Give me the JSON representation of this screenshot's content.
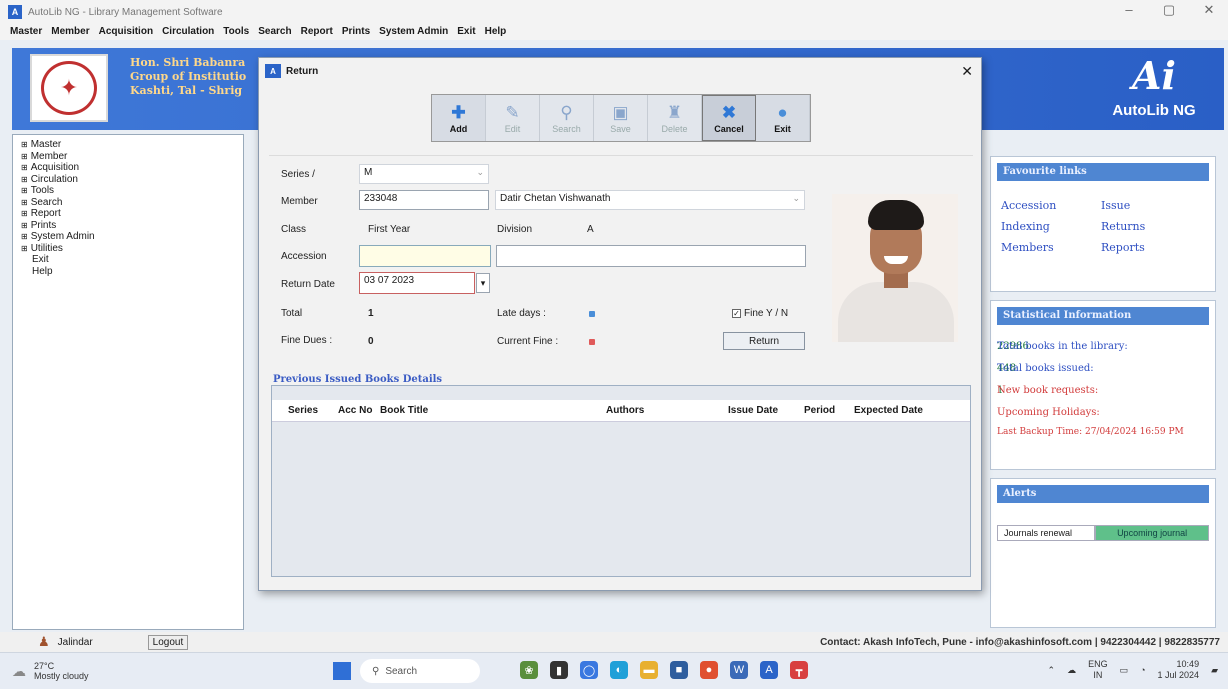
{
  "window": {
    "title": "AutoLib NG - Library Management Software",
    "controls": [
      "–",
      "▢",
      "✕"
    ]
  },
  "menubar": [
    "Master",
    "Member",
    "Acquisition",
    "Circulation",
    "Tools",
    "Search",
    "Report",
    "Prints",
    "System Admin",
    "Exit",
    "Help"
  ],
  "header": {
    "institution_lines": [
      "Hon. Shri Babanra",
      "Group of Institutio",
      "Kashti, Tal - Shrig"
    ],
    "brand_mark": "Ai",
    "brand_name": "AutoLib NG"
  },
  "left_nav": {
    "tree_items": [
      "Master",
      "Member",
      "Acquisition",
      "Circulation",
      "Tools",
      "Search",
      "Report",
      "Prints",
      "System Admin",
      "Utilities"
    ],
    "plain_items": [
      "Exit",
      "Help"
    ]
  },
  "favourite_links": {
    "title": "Favourite links",
    "links": [
      "Accession",
      "Issue",
      "Indexing",
      "Returns",
      "Members",
      "Reports"
    ]
  },
  "statistics": {
    "title": "Statistical Information",
    "rows": [
      {
        "label": "Total books in the library:",
        "value": "22986"
      },
      {
        "label": "Total books issued:",
        "value": "448"
      },
      {
        "label": "New book requests:",
        "value": "1"
      },
      {
        "label": "Upcoming Holidays:",
        "value": ""
      }
    ],
    "last_backup": "Last Backup Time: 27/04/2024 16:59 PM"
  },
  "alerts": {
    "title": "Alerts",
    "tabs": [
      "Journals renewal",
      "Upcoming journal"
    ]
  },
  "statusbar": {
    "user": "Jalindar",
    "logout": "Logout",
    "contact": "Contact: Akash InfoTech, Pune - info@akashinfosoft.com | 9422304442 | 9822835777"
  },
  "dialog": {
    "title": "Return",
    "toolbar": [
      {
        "label": "Add",
        "icon": "add-icon"
      },
      {
        "label": "Edit",
        "icon": "edit-icon"
      },
      {
        "label": "Search",
        "icon": "search-icon"
      },
      {
        "label": "Save",
        "icon": "save-icon"
      },
      {
        "label": "Delete",
        "icon": "delete-icon"
      },
      {
        "label": "Cancel",
        "icon": "cancel-icon"
      },
      {
        "label": "Exit",
        "icon": "exit-icon"
      }
    ],
    "form": {
      "series_label": "Series /",
      "series_value": "M",
      "member_label": "Member",
      "member_id": "233048",
      "member_name": "Datir Chetan Vishwanath",
      "class_label": "Class",
      "class_value": "First Year",
      "division_label": "Division",
      "division_value": "A",
      "accession_label": "Accession",
      "accession_value": "",
      "accession_title_value": "",
      "return_date_label": "Return Date",
      "return_date_value": "03 07 2023",
      "total_label": "Total",
      "total_value": "1",
      "late_days_label": "Late days :",
      "fine_yn_label": "Fine Y / N",
      "fine_dues_label": "Fine Dues :",
      "fine_dues_value": "0",
      "current_fine_label": "Current Fine :",
      "return_button": "Return"
    },
    "previous_books": {
      "title": "Previous Issued Books Details",
      "columns": [
        "Series",
        "Acc No",
        "Book Title",
        "Authors",
        "Issue Date",
        "Period",
        "Expected Date"
      ],
      "rows": []
    }
  },
  "taskbar": {
    "weather_temp": "27°C",
    "weather_desc": "Mostly cloudy",
    "search_placeholder": "Search",
    "lang_top": "ENG",
    "lang_bottom": "IN",
    "time": "10:49",
    "date": "1 Jul 2024"
  },
  "colors": {
    "header_blue": "#3f78d8",
    "link_blue": "#2e4fc2",
    "stat_green": "#1d7a3e",
    "alert_red": "#d23c3c",
    "tab_green": "#5fc08a"
  }
}
